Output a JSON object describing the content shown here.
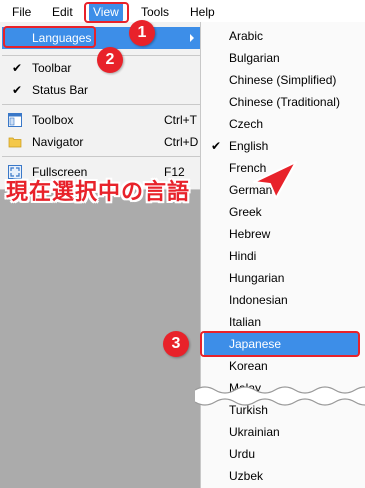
{
  "menubar": {
    "items": [
      {
        "label": "File"
      },
      {
        "label": "Edit"
      },
      {
        "label": "View"
      },
      {
        "label": "Tools"
      },
      {
        "label": "Help"
      }
    ]
  },
  "view_menu": {
    "languages": "Languages",
    "toolbar": "Toolbar",
    "status_bar": "Status Bar",
    "toolbox": "Toolbox",
    "toolbox_shortcut": "Ctrl+T",
    "navigator": "Navigator",
    "navigator_shortcut": "Ctrl+D",
    "fullscreen": "Fullscreen",
    "fullscreen_shortcut": "F12"
  },
  "languages_menu": {
    "items": [
      "Arabic",
      "Bulgarian",
      "Chinese (Simplified)",
      "Chinese (Traditional)",
      "Czech",
      "English",
      "French",
      "German",
      "Greek",
      "Hebrew",
      "Hindi",
      "Hungarian",
      "Indonesian",
      "Italian",
      "Japanese",
      "Korean",
      "Malay",
      "Turkish",
      "Ukrainian",
      "Urdu",
      "Uzbek"
    ],
    "checked": "English",
    "highlighted": "Japanese"
  },
  "annotations": {
    "badge1": "1",
    "badge2": "2",
    "badge3": "3",
    "current_selection_note": "現在選択中の言語",
    "color": "#e8222a"
  },
  "colors": {
    "highlight": "#3d8ee8",
    "annotation_red": "#e8222a",
    "app_background": "#ababab"
  }
}
